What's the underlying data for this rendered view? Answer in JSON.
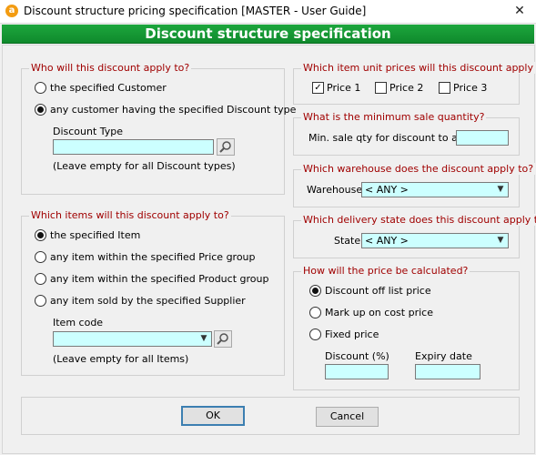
{
  "window": {
    "title": "Discount structure pricing specification [MASTER - User Guide]",
    "app_icon": "a",
    "close_symbol": "✕"
  },
  "banner": {
    "title": "Discount structure specification"
  },
  "who": {
    "legend": "Who will this discount apply to?",
    "opt_customer": "the specified Customer",
    "opt_discount_type": "any customer having the specified Discount type",
    "selected": "discount_type",
    "discount_type_label": "Discount Type",
    "discount_type_value": "",
    "hint": "(Leave empty for all Discount types)"
  },
  "items": {
    "legend": "Which items will this discount apply to?",
    "opt_item": "the specified Item",
    "opt_price_group": "any item within the specified Price group",
    "opt_product_group": "any item within the specified Product group",
    "opt_supplier": "any item sold by the specified Supplier",
    "selected": "item",
    "item_code_label": "Item code",
    "item_code_value": "",
    "hint": "(Leave empty for all Items)"
  },
  "unit_prices": {
    "legend": "Which item unit prices will this discount apply to?",
    "price1": "Price 1",
    "price1_checked": true,
    "price2": "Price 2",
    "price2_checked": false,
    "price3": "Price 3",
    "price3_checked": false
  },
  "min_qty": {
    "legend": "What is the minimum sale quantity?",
    "label": "Min. sale qty for discount to apply:",
    "value": ""
  },
  "warehouse": {
    "legend": "Which warehouse does the discount apply to?",
    "label": "Warehouse:",
    "value": "< ANY >"
  },
  "delivery_state": {
    "legend": "Which delivery state does this discount apply to?",
    "label": "State:",
    "value": "< ANY >"
  },
  "calc": {
    "legend": "How will the price be calculated?",
    "opt_discount": "Discount off list price",
    "opt_markup": "Mark up on cost price",
    "opt_fixed": "Fixed price",
    "selected": "discount",
    "discount_label": "Discount (%)",
    "discount_value": "",
    "expiry_label": "Expiry date",
    "expiry_value": ""
  },
  "buttons": {
    "ok": "OK",
    "cancel": "Cancel"
  },
  "colors": {
    "banner": "#1da63d",
    "legend_text": "#a00000",
    "input_bg": "#ccffff"
  }
}
